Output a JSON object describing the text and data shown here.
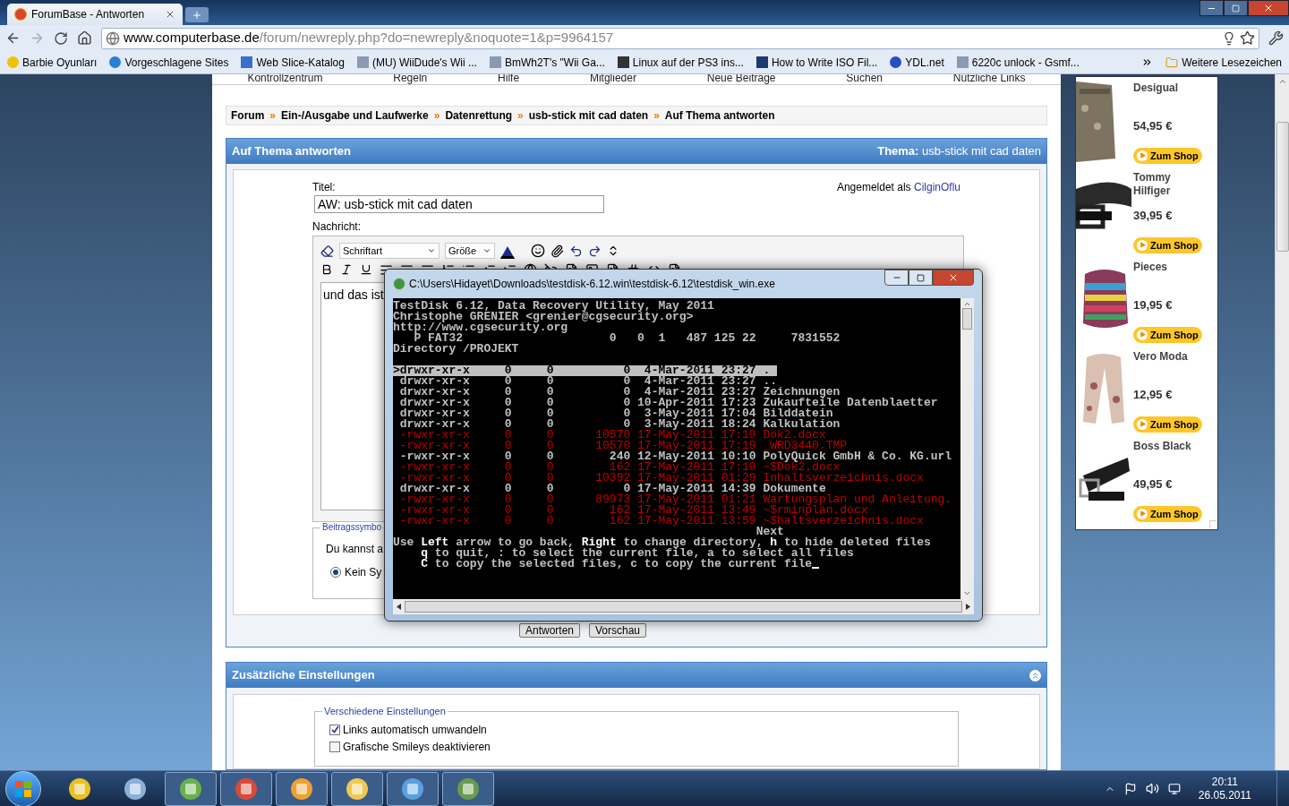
{
  "browser": {
    "tab_title": "ForumBase - Antworten",
    "url_host": "www.computerbase.de",
    "url_path": "/forum/newreply.php?do=newreply&noquote=1&p=9964157",
    "bookmarks": [
      "Barbie Oyunları",
      "Vorgeschlagene Sites",
      "Web Slice-Katalog",
      "(MU) WiiDude's Wii ...",
      "BmWh2T's \"Wii Ga...",
      "Linux auf der PS3 ins...",
      "How to Write ISO Fil...",
      "YDL.net",
      "6220c unlock - Gsmf..."
    ],
    "other_bookmarks": "Weitere Lesezeichen"
  },
  "forum": {
    "nav": [
      "Kontrollzentrum",
      "Regeln",
      "Hilfe",
      "Mitglieder",
      "Neue Beiträge",
      "Suchen",
      "Nützliche Links"
    ],
    "breadcrumb_separator": "»",
    "breadcrumb": [
      "Forum",
      "Ein-/Ausgabe und Laufwerke",
      "Datenrettung",
      "usb-stick mit cad daten",
      "Auf Thema antworten"
    ],
    "reply": {
      "title": "Auf Thema antworten",
      "topic_label": "Thema:",
      "topic": "usb-stick mit cad daten",
      "title_label": "Titel:",
      "title_value": "AW: usb-stick mit cad daten",
      "logged_in": "Angemeldet als",
      "user": "CilginOflu",
      "message_label": "Nachricht:",
      "font_select": "Schriftart",
      "size_select": "Größe",
      "message": "und das ist",
      "icon_legend": "Beitragssymbo",
      "icon_hint": "Du kannst a",
      "icon_option": {
        "label": "Kein Sy",
        "selected": true
      }
    },
    "buttons": [
      "Antworten",
      "Vorschau"
    ],
    "settings": {
      "title": "Zusätzliche Einstellungen",
      "legend": "Verschiedene Einstellungen",
      "options": [
        {
          "label": "Links automatisch umwandeln",
          "checked": true
        },
        {
          "label": "Grafische Smileys deaktivieren",
          "checked": false
        }
      ]
    }
  },
  "ads": [
    {
      "brand": "Desigual",
      "price": "54,95 €",
      "button": "Zum Shop"
    },
    {
      "brand": "Tommy Hilfiger",
      "price": "39,95 €",
      "button": "Zum Shop"
    },
    {
      "brand": "Pieces",
      "price": "19,95 €",
      "button": "Zum Shop"
    },
    {
      "brand": "Vero Moda",
      "price": "12,95 €",
      "button": "Zum Shop"
    },
    {
      "brand": "Boss Black",
      "price": "49,95 €",
      "button": "Zum Shop"
    }
  ],
  "terminal": {
    "title": "C:\\Users\\Hidayet\\Downloads\\testdisk-6.12.win\\testdisk-6.12\\testdisk_win.exe",
    "header": [
      "TestDisk 6.12, Data Recovery Utility, May 2011",
      "Christophe GRENIER <grenier@cgsecurity.org>",
      "http://www.cgsecurity.org",
      "   P FAT32                     0   0  1   487 125 22     7831552",
      "Directory /PROJEKT"
    ],
    "entries": [
      {
        "perms": "drwxr-xr-x",
        "uid": "0",
        "gid": "0",
        "size": "0",
        "date": "4-Mar-2011",
        "time": "23:27",
        "name": ".",
        "deleted": false,
        "selected": true
      },
      {
        "perms": "drwxr-xr-x",
        "uid": "0",
        "gid": "0",
        "size": "0",
        "date": "4-Mar-2011",
        "time": "23:27",
        "name": "..",
        "deleted": false,
        "selected": false
      },
      {
        "perms": "drwxr-xr-x",
        "uid": "0",
        "gid": "0",
        "size": "0",
        "date": "4-Mar-2011",
        "time": "23:27",
        "name": "Zeichnungen",
        "deleted": false,
        "selected": false
      },
      {
        "perms": "drwxr-xr-x",
        "uid": "0",
        "gid": "0",
        "size": "0",
        "date": "10-Apr-2011",
        "time": "17:23",
        "name": "Zukaufteile Datenblaetter",
        "deleted": false,
        "selected": false
      },
      {
        "perms": "drwxr-xr-x",
        "uid": "0",
        "gid": "0",
        "size": "0",
        "date": "3-May-2011",
        "time": "17:04",
        "name": "Bilddatein",
        "deleted": false,
        "selected": false
      },
      {
        "perms": "drwxr-xr-x",
        "uid": "0",
        "gid": "0",
        "size": "0",
        "date": "3-May-2011",
        "time": "18:24",
        "name": "Kalkulation",
        "deleted": false,
        "selected": false
      },
      {
        "perms": "-rwxr-xr-x",
        "uid": "0",
        "gid": "0",
        "size": "10570",
        "date": "17-May-2011",
        "time": "17:19",
        "name": "Dok2.docx",
        "deleted": true,
        "selected": false
      },
      {
        "perms": "-rwxr-xr-x",
        "uid": "0",
        "gid": "0",
        "size": "10570",
        "date": "17-May-2011",
        "time": "17:19",
        "name": "_WRD3440.TMP",
        "deleted": true,
        "selected": false
      },
      {
        "perms": "-rwxr-xr-x",
        "uid": "0",
        "gid": "0",
        "size": "240",
        "date": "12-May-2011",
        "time": "10:10",
        "name": "PolyQuick GmbH & Co. KG.url",
        "deleted": false,
        "selected": false
      },
      {
        "perms": "-rwxr-xr-x",
        "uid": "0",
        "gid": "0",
        "size": "162",
        "date": "17-May-2011",
        "time": "17:19",
        "name": "~$Dok2.docx",
        "deleted": true,
        "selected": false
      },
      {
        "perms": "-rwxr-xr-x",
        "uid": "0",
        "gid": "0",
        "size": "10392",
        "date": "17-May-2011",
        "time": "01:29",
        "name": "Inhaltsverzeichnis.docx",
        "deleted": true,
        "selected": false
      },
      {
        "perms": "drwxr-xr-x",
        "uid": "0",
        "gid": "0",
        "size": "0",
        "date": "17-May-2011",
        "time": "14:39",
        "name": "Dokumente",
        "deleted": false,
        "selected": false
      },
      {
        "perms": "-rwxr-xr-x",
        "uid": "0",
        "gid": "0",
        "size": "89973",
        "date": "17-May-2011",
        "time": "01:21",
        "name": "Wartungsplan und Anleitung.",
        "deleted": true,
        "selected": false
      },
      {
        "perms": "-rwxr-xr-x",
        "uid": "0",
        "gid": "0",
        "size": "162",
        "date": "17-May-2011",
        "time": "13:49",
        "name": "~$rminplan.docx",
        "deleted": true,
        "selected": false
      },
      {
        "perms": "-rwxr-xr-x",
        "uid": "0",
        "gid": "0",
        "size": "162",
        "date": "17-May-2011",
        "time": "13:59",
        "name": "~$haltsverzeichnis.docx",
        "deleted": true,
        "selected": false
      }
    ],
    "pointer": ">",
    "next": "Next",
    "help": [
      "Use **Left** arrow to go back, **Right** to change directory, **h** to hide deleted files",
      "    **q** to quit, : to select the current file, a to select all files",
      "    **C** to copy the selected files, c to copy the current file"
    ]
  },
  "taskbar": {
    "apps": [
      {
        "running": false
      },
      {
        "running": false
      },
      {
        "running": true
      },
      {
        "running": true
      },
      {
        "running": true
      },
      {
        "running": true
      },
      {
        "running": true
      },
      {
        "running": true
      }
    ],
    "time": "20:11",
    "date": "26.05.2011"
  }
}
